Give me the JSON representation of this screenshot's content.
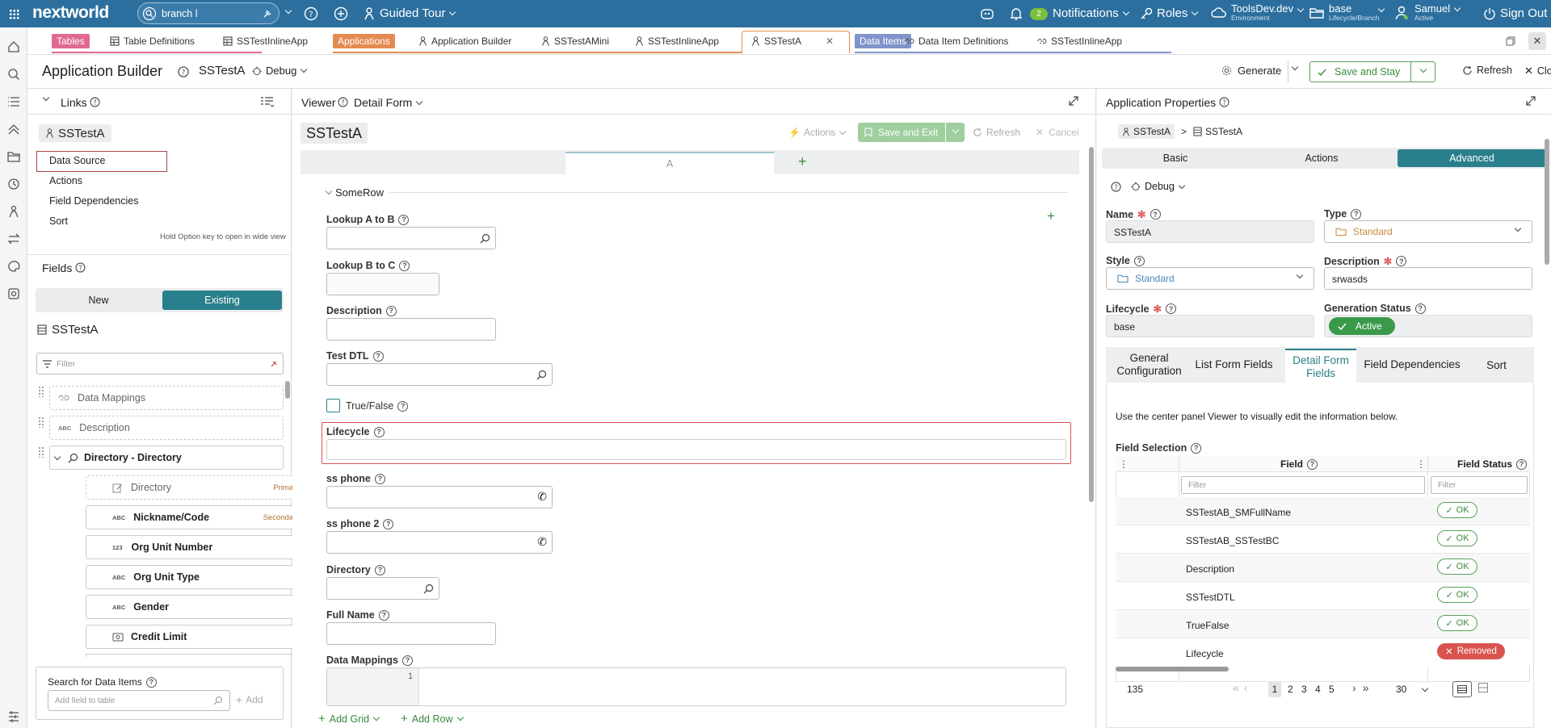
{
  "topbar": {
    "logo": "nextworld",
    "search_value": "branch l",
    "guided_tour": "Guided Tour",
    "notif_count": "2",
    "notifications": "Notifications",
    "roles": "Roles",
    "env_name": "ToolsDev.dev",
    "env_label": "Environment",
    "branch_name": "base",
    "branch_label": "Lifecycle/Branch",
    "user_name": "Samuel",
    "user_status": "Active",
    "signout": "Sign Out"
  },
  "tabs": [
    {
      "label": "Tables"
    },
    {
      "label": "Table Definitions"
    },
    {
      "label": "SSTestInlineApp"
    },
    {
      "label": "Applications"
    },
    {
      "label": "Application Builder"
    },
    {
      "label": "SSTestAMini"
    },
    {
      "label": "SSTestInlineApp"
    },
    {
      "label": "SSTestA"
    },
    {
      "label": "Data Items"
    },
    {
      "label": "Data Item Definitions"
    },
    {
      "label": "SSTestInlineApp"
    }
  ],
  "header": {
    "title": "Application Builder",
    "app_name": "SSTestA",
    "debug": "Debug",
    "generate": "Generate",
    "save_stay": "Save and Stay",
    "refresh": "Refresh",
    "close": "Close"
  },
  "links": {
    "title": "Links",
    "app": "SSTestA",
    "items": [
      "Data Source",
      "Actions",
      "Field Dependencies",
      "Sort"
    ],
    "hint": "Hold Option key to open in wide view"
  },
  "fields_panel": {
    "title": "Fields",
    "new": "New",
    "existing": "Existing",
    "table": "SSTestA",
    "filter_placeholder": "Filter",
    "items": [
      {
        "type": "map",
        "label": "Data Mappings",
        "tag": ""
      },
      {
        "type": "ABC",
        "label": "Description",
        "tag": ""
      },
      {
        "type": "search",
        "label": "Directory - Directory",
        "tag": ""
      },
      {
        "type": "edit",
        "label": "Directory",
        "tag": "Primary"
      },
      {
        "type": "ABC",
        "label": "Nickname/Code",
        "tag": "Secondary"
      },
      {
        "type": "123",
        "label": "Org Unit Number",
        "tag": ""
      },
      {
        "type": "ABC",
        "label": "Org Unit Type",
        "tag": ""
      },
      {
        "type": "ABC",
        "label": "Gender",
        "tag": ""
      },
      {
        "type": "money",
        "label": "Credit Limit",
        "tag": ""
      }
    ],
    "search_label": "Search for Data Items",
    "search_placeholder": "Add field to table",
    "add": "Add"
  },
  "viewer": {
    "title": "Viewer",
    "mode": "Detail Form",
    "form_title": "SSTestA",
    "actions": "Actions",
    "save_exit": "Save and Exit",
    "refresh": "Refresh",
    "cancel": "Cancel",
    "tab_a": "A",
    "row_name": "SomeRow",
    "fields": [
      "Lookup A to B",
      "Lookup B to C",
      "Description",
      "Test DTL",
      "True/False",
      "Lifecycle",
      "ss phone",
      "ss phone 2",
      "Directory",
      "Full Name",
      "Data Mappings"
    ],
    "code_line": "1",
    "add_grid": "Add Grid",
    "add_row": "Add Row"
  },
  "props": {
    "title": "Application Properties",
    "crumb1": "SSTestA",
    "crumb2": "SSTestA",
    "tabs": [
      "Basic",
      "Actions",
      "Advanced"
    ],
    "debug": "Debug",
    "name_label": "Name",
    "name_value": "SSTestA",
    "type_label": "Type",
    "type_value": "Standard",
    "style_label": "Style",
    "style_value": "Standard",
    "desc_label": "Description",
    "desc_value": "srwasds",
    "lifecycle_label": "Lifecycle",
    "lifecycle_value": "base",
    "gen_label": "Generation Status",
    "gen_value": "Active",
    "subtabs": [
      "General Configuration",
      "List Form Fields",
      "Detail Form Fields",
      "Field Dependencies",
      "Sort"
    ],
    "hint": "Use the center panel Viewer to visually edit the information below.",
    "selection_label": "Field Selection",
    "col_field": "Field",
    "col_status": "Field Status",
    "filter": "Filter",
    "rows": [
      {
        "field": "SSTestAB_SMFullName",
        "status": "OK"
      },
      {
        "field": "SSTestAB_SSTestBC",
        "status": "OK"
      },
      {
        "field": "Description",
        "status": "OK"
      },
      {
        "field": "SSTestDTL",
        "status": "OK"
      },
      {
        "field": "TrueFalse",
        "status": "OK"
      },
      {
        "field": "Lifecycle",
        "status": "Removed"
      }
    ],
    "total": "135",
    "pages": [
      "1",
      "2",
      "3",
      "4",
      "5"
    ],
    "page_size": "30"
  }
}
